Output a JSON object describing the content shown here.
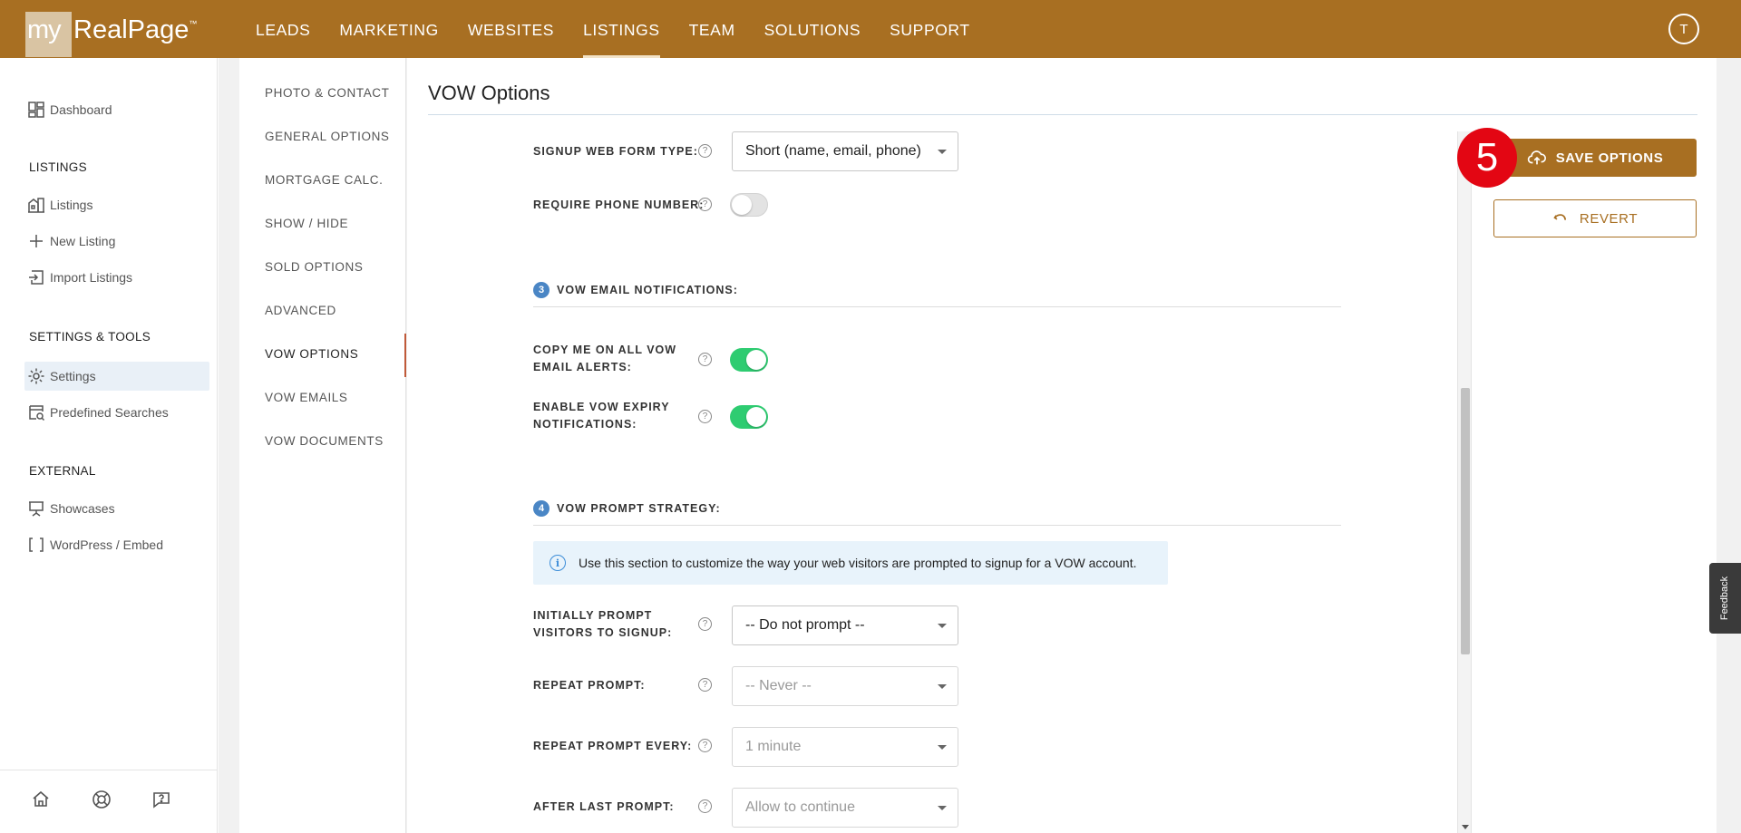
{
  "app": {
    "logo_my": "my",
    "logo_name": "RealPage",
    "logo_tm": "™",
    "brand_color": "#a86f22",
    "avatar_initial": "T"
  },
  "topnav": [
    {
      "label": "LEADS",
      "active": false
    },
    {
      "label": "MARKETING",
      "active": false
    },
    {
      "label": "WEBSITES",
      "active": false
    },
    {
      "label": "LISTINGS",
      "active": true
    },
    {
      "label": "TEAM",
      "active": false
    },
    {
      "label": "SOLUTIONS",
      "active": false
    },
    {
      "label": "SUPPORT",
      "active": false
    }
  ],
  "sidebar": {
    "dashboard": "Dashboard",
    "listings_header": "LISTINGS",
    "listings": "Listings",
    "new_listing": "New Listing",
    "import_listings": "Import Listings",
    "settings_header": "SETTINGS & TOOLS",
    "settings": "Settings",
    "predefined_searches": "Predefined Searches",
    "external_header": "EXTERNAL",
    "showcases": "Showcases",
    "wordpress": "WordPress / Embed",
    "bottom_icons": [
      "home-icon",
      "support-icon",
      "chat-help-icon"
    ]
  },
  "subnav": [
    {
      "label": "PHOTO & CONTACT",
      "active": false
    },
    {
      "label": "GENERAL OPTIONS",
      "active": false
    },
    {
      "label": "MORTGAGE CALC.",
      "active": false
    },
    {
      "label": "SHOW / HIDE",
      "active": false
    },
    {
      "label": "SOLD OPTIONS",
      "active": false
    },
    {
      "label": "ADVANCED",
      "active": false
    },
    {
      "label": "VOW OPTIONS",
      "active": true
    },
    {
      "label": "VOW EMAILS",
      "active": false
    },
    {
      "label": "VOW DOCUMENTS",
      "active": false
    }
  ],
  "main": {
    "title": "VOW Options",
    "signup_form_label": "SIGNUP WEB FORM TYPE:",
    "signup_form_value": "Short (name, email, phone)",
    "require_phone_label": "REQUIRE PHONE NUMBER:",
    "require_phone_on": false,
    "section3_num": "3",
    "section3_title": "VOW EMAIL NOTIFICATIONS:",
    "copy_me_label_1": "COPY ME ON ALL VOW",
    "copy_me_label_2": "EMAIL ALERTS:",
    "copy_me_on": true,
    "expiry_label_1": "ENABLE VOW EXPIRY",
    "expiry_label_2": "NOTIFICATIONS:",
    "expiry_on": true,
    "section4_num": "4",
    "section4_title": "VOW PROMPT STRATEGY:",
    "info_text": "Use this section to customize the way your web visitors are prompted to signup for a VOW account.",
    "initial_prompt_label_1": "INITIALLY PROMPT",
    "initial_prompt_label_2": "VISITORS TO SIGNUP:",
    "initial_prompt_value": "-- Do not prompt --",
    "repeat_prompt_label": "REPEAT PROMPT:",
    "repeat_prompt_value": "-- Never --",
    "repeat_every_label": "REPEAT PROMPT EVERY:",
    "repeat_every_value": "1 minute",
    "after_last_label": "AFTER LAST PROMPT:",
    "after_last_value": "Allow to continue",
    "help_glyph": "?"
  },
  "actions": {
    "save_label": "SAVE OPTIONS",
    "revert_label": "REVERT",
    "step_badge": "5"
  },
  "feedback_label": "Feedback",
  "colors": {
    "toggle_on": "#2ecc71",
    "section_badge": "#4a86c5",
    "step_badge": "#e30613"
  }
}
